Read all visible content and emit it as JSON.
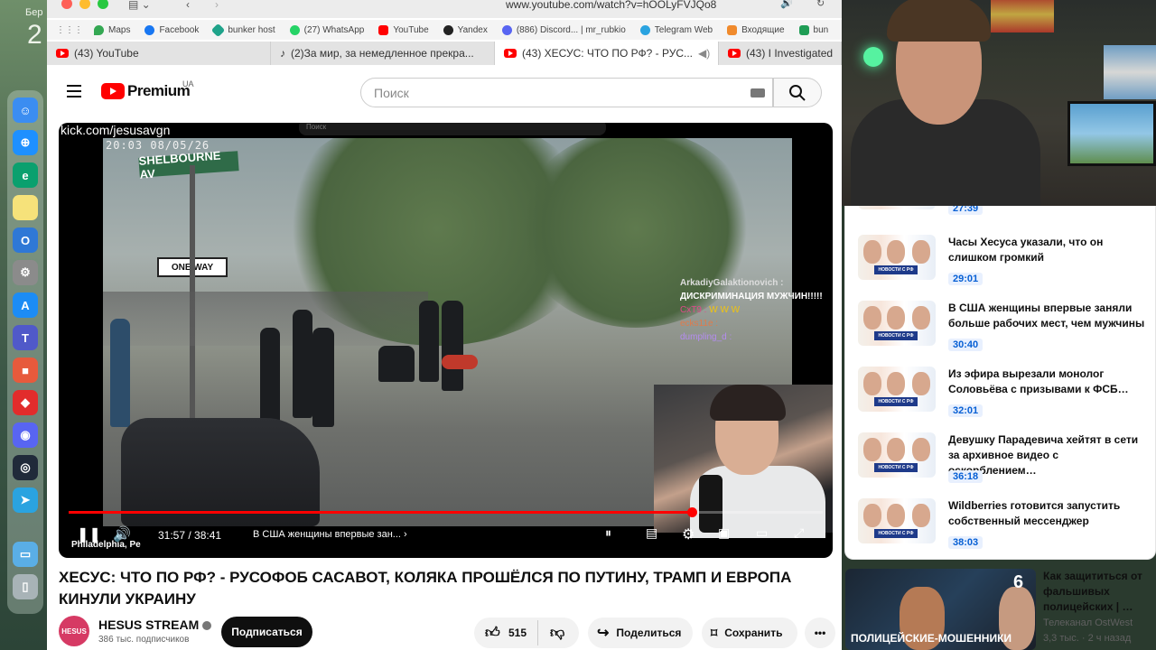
{
  "desktop": {
    "date_label": "Бер",
    "day": "2"
  },
  "browser": {
    "url": "www.youtube.com/watch?v=hOOLyFVJQo8",
    "bookmarks": [
      "Maps",
      "Facebook",
      "bunker host",
      "(27) WhatsApp",
      "YouTube",
      "Yandex",
      "(886) Discord... | mr_rubkio",
      "Telegram Web",
      "Входящие",
      "bun"
    ],
    "tabs": [
      "(43) YouTube",
      "(2)За мир, за немедленное прекра...",
      "(43) ХЕСУС: ЧТО ПО РФ? - РУС...",
      "(43) I Investigated"
    ]
  },
  "header": {
    "logo_text": "Premium",
    "region": "UA",
    "search_placeholder": "Поиск"
  },
  "player": {
    "kick_label": "kick.com/jesusavgn",
    "cam_time": "20:03 08/05/26",
    "street_sign": "SHELBOURNE AV",
    "oneway": "ONE WAY",
    "stream_search": "Поиск",
    "chat": [
      {
        "user": "ArkadiyGalaktionovich :",
        "text": "ДИСКРИМИНАЦИЯ МУЖЧИН!!!!!"
      },
      {
        "user": "CxT9 :",
        "text": "W W W"
      },
      {
        "user": "ecks11e :",
        "text": ""
      },
      {
        "user": "dumpling_d :",
        "text": ""
      }
    ],
    "overlay_location": "Philadelphia, Pe",
    "time": "31:57 / 38:41",
    "chapter": "В США женщины впервые зан...",
    "progress": 0.826
  },
  "video": {
    "title": "ХЕСУС: ЧТО ПО РФ? - РУСОФОБ САСАВОТ, КОЛЯКА ПРОШЁЛСЯ ПО ПУТИНУ, ТРАМП И ЕВРОПА КИНУЛИ УКРАИНУ",
    "channel": "HESUS STREAM",
    "channel_avatar_text": "HESUS",
    "subscribers": "386 тыс. подписчиков",
    "subscribe": "Подписаться",
    "likes": "515",
    "share": "Поделиться",
    "save": "Сохранить",
    "more": "•••"
  },
  "sidebar": {
    "top_duration": "27:39",
    "thumb_banner": "НОВОСТИ С РФ",
    "items": [
      {
        "title": "Часы Хесуса указали, что он слишком громкий",
        "duration": "29:01"
      },
      {
        "title": "В США женщины впервые заняли больше рабочих мест, чем мужчины",
        "duration": "30:40"
      },
      {
        "title": "Из эфира вырезали монолог Соловьёва с призывами к ФСБ…",
        "duration": "32:01"
      },
      {
        "title": "Девушку Парадевича хейтят в сети за архивное видео с оскорблением…",
        "duration": "36:18"
      },
      {
        "title": "Wildberries готовится запустить собственный мессенджер",
        "duration": "38:03"
      }
    ]
  },
  "promo": {
    "title": "Как защититься от фальшивых полицейских | …",
    "channel": "Телеканал OstWest",
    "meta": "3,3 тыс. · 2 ч назад",
    "thumb_text": "ПОЛИЦЕЙСКИЕ-МОШЕННИКИ",
    "badge": "6"
  },
  "colors": {
    "youtube_red": "#ff0000",
    "duration_blue": "#065fd4",
    "subscribe_black": "#0f0f0f"
  }
}
